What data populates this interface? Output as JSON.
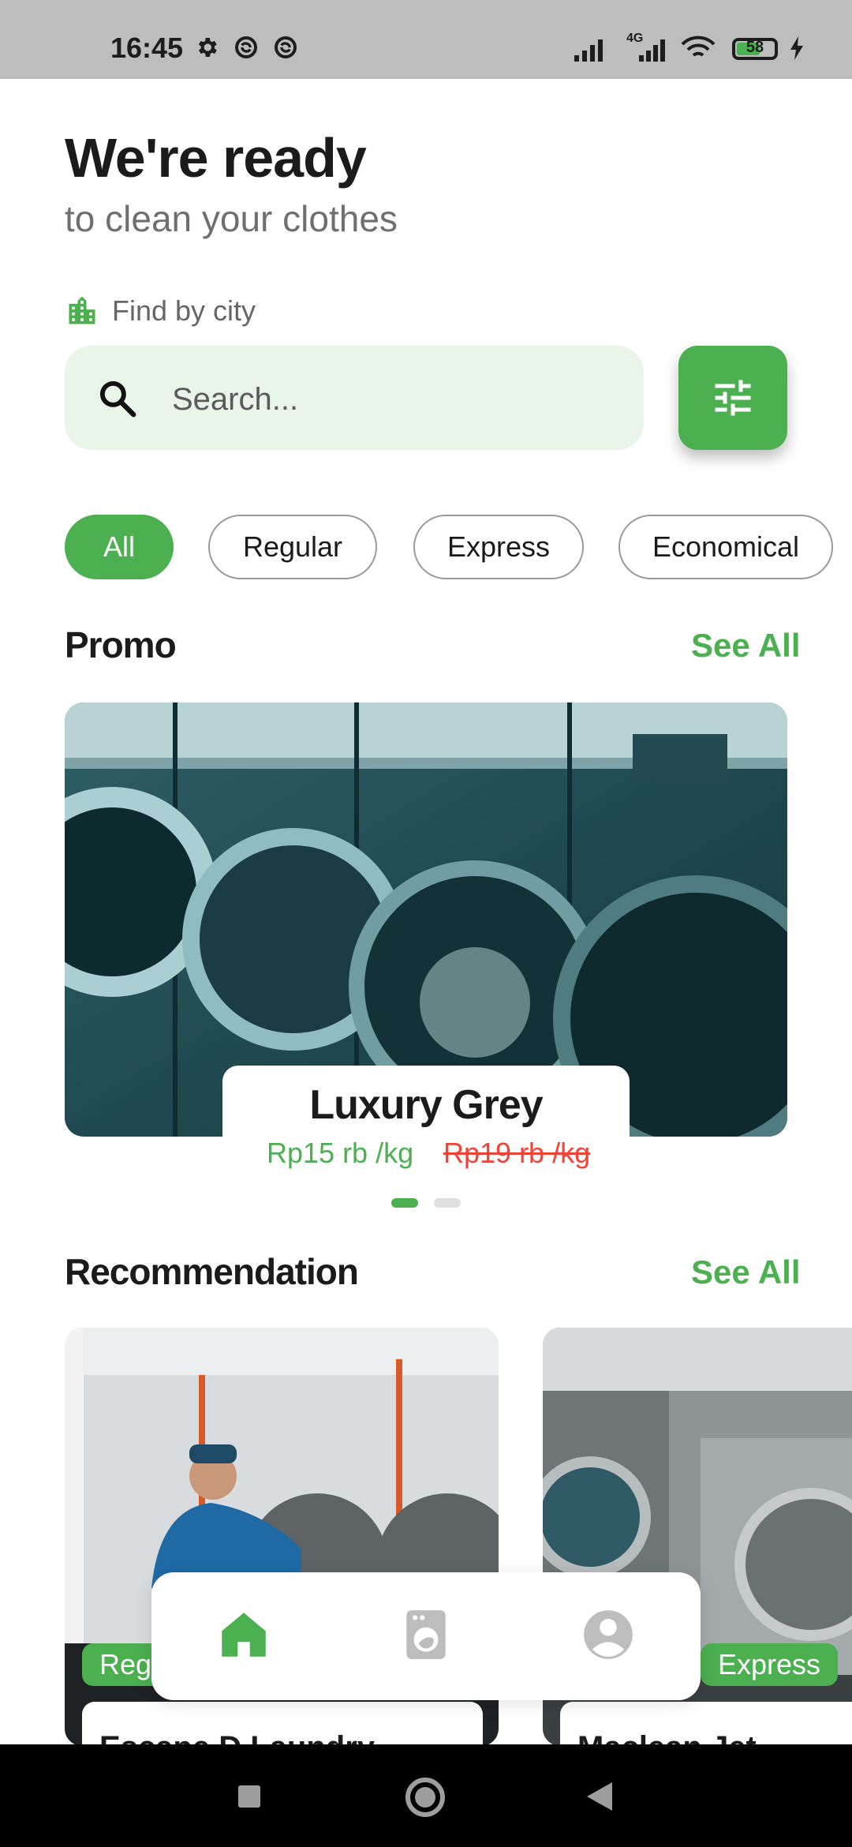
{
  "status_bar": {
    "time": "16:45",
    "network": "4G",
    "battery": "58",
    "icons": [
      "gear-icon",
      "sync-icon",
      "sync-icon",
      "signal-icon",
      "signal-4g-icon",
      "wifi-icon",
      "battery-icon",
      "charging-icon"
    ]
  },
  "header": {
    "title": "We're ready",
    "subtitle": "to clean your clothes",
    "city_label": "Find by city"
  },
  "search": {
    "placeholder": "Search..."
  },
  "chips": [
    {
      "label": "All",
      "active": true
    },
    {
      "label": "Regular",
      "active": false
    },
    {
      "label": "Express",
      "active": false
    },
    {
      "label": "Economical",
      "active": false
    }
  ],
  "promo": {
    "title": "Promo",
    "see_all": "See All",
    "card": {
      "name": "Luxury Grey",
      "price": "Rp15 rb /kg",
      "old_price": "Rp19 rb /kg"
    },
    "pages": 2,
    "active_page": 1
  },
  "recommendation": {
    "title": "Recommendation",
    "see_all": "See All",
    "cards": [
      {
        "name": "Escape D Laundry",
        "badge": "Regular"
      },
      {
        "name": "Maclean Jet",
        "badge": "Express"
      }
    ]
  },
  "tabs": [
    {
      "icon": "home-icon",
      "active": true
    },
    {
      "icon": "washing-machine-icon",
      "active": false
    },
    {
      "icon": "profile-icon",
      "active": false
    }
  ],
  "colors": {
    "accent": "#4caf50",
    "accent_light": "#e8f5e8",
    "danger": "#f44336",
    "inactive_icon": "#bdbdbd"
  }
}
